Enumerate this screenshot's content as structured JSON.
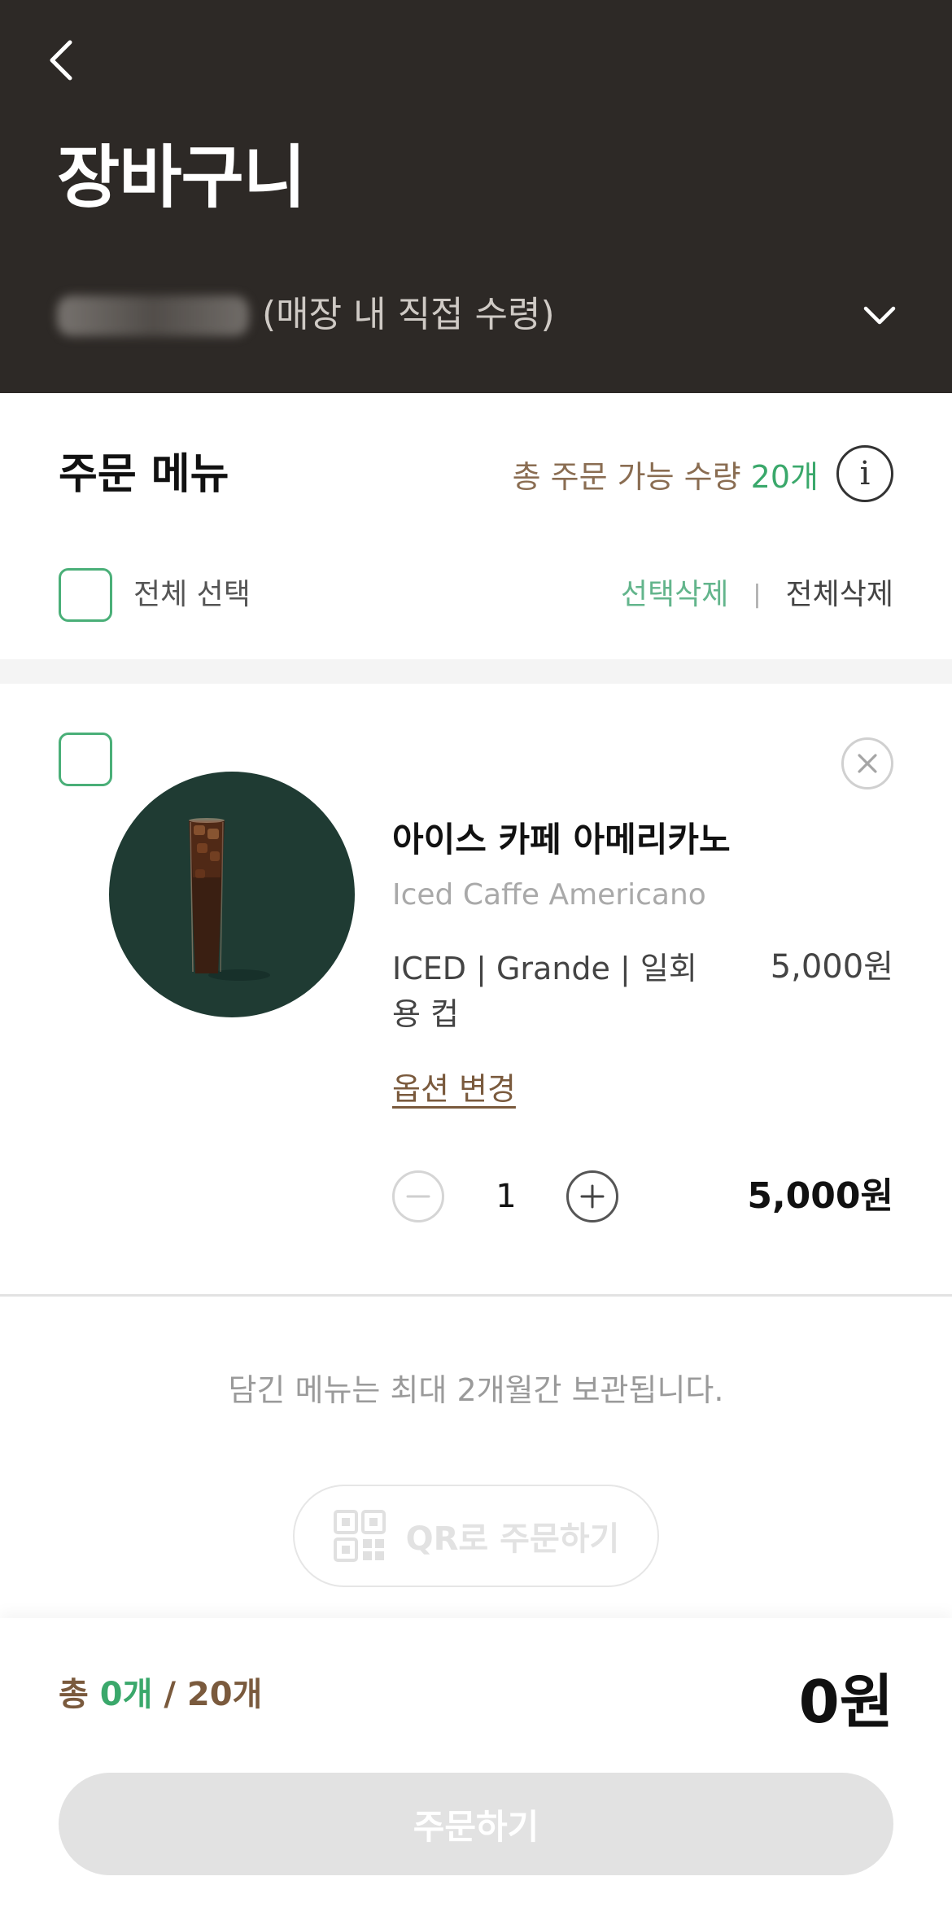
{
  "header": {
    "title": "장바구니",
    "store_name": "",
    "store_suffix": "(매장 내 직접 수령)",
    "colors": {
      "background": "#2d2926"
    },
    "icons": {
      "back": "chevron-left-icon",
      "store_toggle": "chevron-down-icon"
    }
  },
  "order_menu": {
    "title": "주문 메뉴",
    "limit_prefix": "총 주문 가능 수량",
    "limit_value": "20개",
    "info_icon": "info-icon",
    "select_all_label": "전체 선택",
    "delete_selected_label": "선택삭제",
    "delete_separator": "|",
    "delete_all_label": "전체삭제"
  },
  "cart_items": [
    {
      "name_ko": "아이스 카페 아메리카노",
      "name_en": "Iced Caffe Americano",
      "options": "ICED | Grande | 일회용 컵",
      "unit_price": "5,000원",
      "option_change_label": "옵션 변경",
      "quantity": "1",
      "line_total": "5,000원",
      "checked": false,
      "image_background": "#1f3b33"
    }
  ],
  "storage_notice": "담긴 메뉴는 최대 2개월간 보관됩니다.",
  "qr_button": {
    "label": "QR로 주문하기",
    "icon": "qr-code-icon"
  },
  "summary": {
    "total_prefix": "총",
    "selected_count": "0개",
    "count_separator": "/",
    "max_count": "20개",
    "total_price": "0원"
  },
  "order_button": {
    "label": "주문하기",
    "enabled": false
  },
  "accent_colors": {
    "green": "#3aa86b",
    "brown": "#7a5a3d",
    "disabled": "#e2e2e2"
  }
}
